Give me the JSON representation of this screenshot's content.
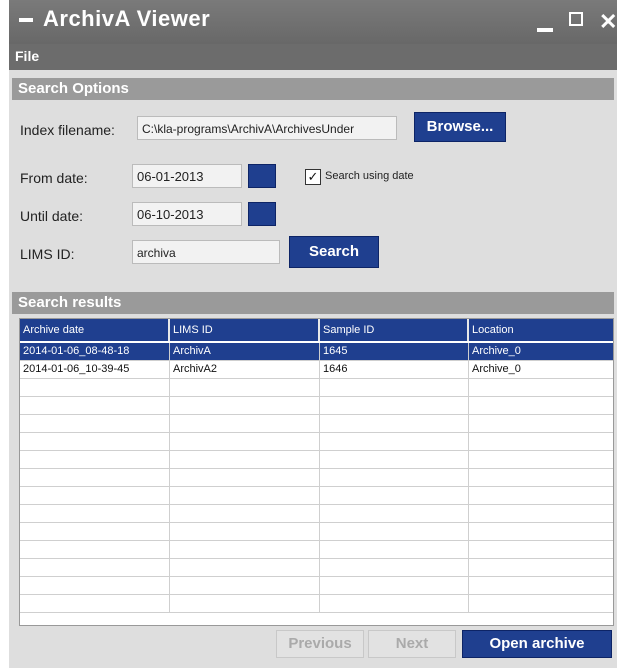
{
  "window": {
    "title": "ArchivA Viewer"
  },
  "menu": {
    "file": "File"
  },
  "search_options": {
    "header": "Search Options",
    "index_label": "Index filename:",
    "index_value": "C:\\kla-programs\\ArchivA\\ArchivesUnder",
    "browse_label": "Browse...",
    "from_label": "From date:",
    "from_value": "06-01-2013",
    "until_label": "Until date:",
    "until_value": "06-10-2013",
    "use_date_label": "Search using date",
    "use_date_checked": true,
    "lims_label": "LIMS ID:",
    "lims_value": "archiva",
    "search_label": "Search"
  },
  "results": {
    "header": "Search results",
    "columns": [
      "Archive date",
      "LIMS ID",
      "Sample ID",
      "Location"
    ],
    "rows": [
      [
        "2014-01-06_08-48-18",
        "ArchivA",
        "1645",
        "Archive_0"
      ],
      [
        "2014-01-06_10-39-45",
        "ArchivA2",
        "1646",
        "Archive_0"
      ]
    ],
    "selected_row": 0
  },
  "footer": {
    "previous": "Previous",
    "next": "Next",
    "open": "Open archive"
  },
  "colors": {
    "accent": "#1f3f8f",
    "titlebar": "#6c6c6c",
    "panel": "#dedede"
  }
}
